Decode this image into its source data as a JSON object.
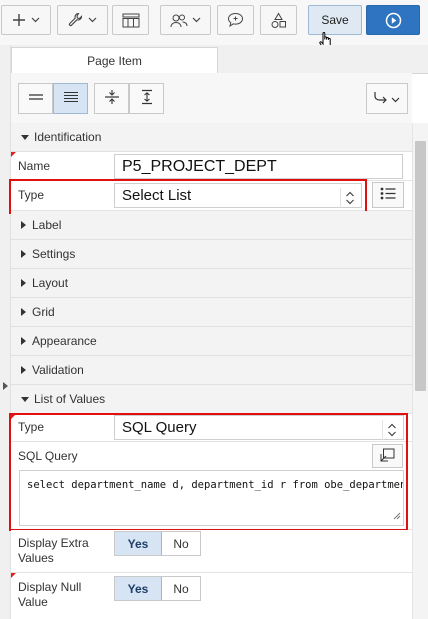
{
  "toolbar": {
    "save_label": "Save",
    "colors": {
      "run_button": "#2f74c0",
      "save_button": "#dfe9f4"
    }
  },
  "tabs": {
    "active_label": "Page Item"
  },
  "groups": {
    "identification": "Identification",
    "label": "Label",
    "settings": "Settings",
    "layout": "Layout",
    "grid": "Grid",
    "appearance": "Appearance",
    "validation": "Validation",
    "list_of_values": "List of Values"
  },
  "identification": {
    "name_label": "Name",
    "name_value": "P5_PROJECT_DEPT",
    "type_label": "Type",
    "type_value": "Select List"
  },
  "lov": {
    "type_label": "Type",
    "type_value": "SQL Query",
    "sql_label": "SQL Query",
    "sql_value": "select department_name d, department_id r from obe_departments",
    "display_extra_label_1": "Display Extra",
    "display_extra_label_2": "Values",
    "display_null_label_1": "Display Null",
    "display_null_label_2": "Value",
    "yes": "Yes",
    "no": "No"
  },
  "highlight_color": "#e01010"
}
